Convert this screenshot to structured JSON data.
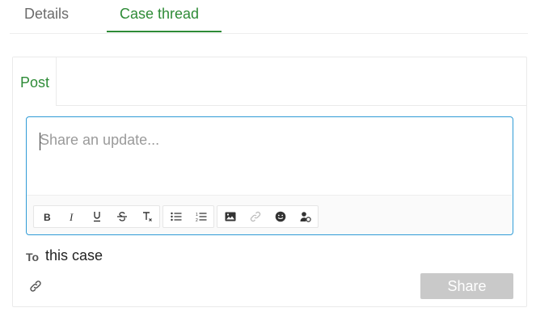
{
  "tabs": {
    "details": "Details",
    "case_thread": "Case thread",
    "active": "case_thread"
  },
  "panel": {
    "post_tab": "Post"
  },
  "editor": {
    "placeholder": "Share an update...",
    "value": "",
    "toolbar": {
      "format_group": [
        "bold-icon",
        "italic-icon",
        "underline-icon",
        "strikethrough-icon",
        "clear-format-icon"
      ],
      "list_group": [
        "bulleted-list-icon",
        "numbered-list-icon"
      ],
      "insert_group": [
        "image-icon",
        "link-icon",
        "emoji-icon",
        "mention-user-icon"
      ]
    }
  },
  "recipient": {
    "label": "To",
    "value": "this case"
  },
  "actions": {
    "share_label": "Share",
    "share_enabled": false
  },
  "colors": {
    "accent_green": "#2e8b37",
    "focus_blue": "#2f9bd6",
    "disabled_button": "#c9c9c9"
  }
}
